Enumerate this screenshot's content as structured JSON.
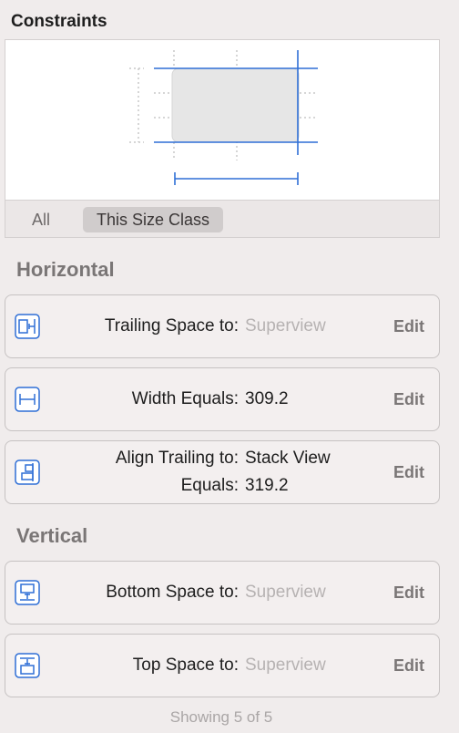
{
  "panel": {
    "title": "Constraints",
    "accent_color": "#2f6fd6"
  },
  "size_class": {
    "all_label": "All",
    "selected_label": "This Size Class"
  },
  "horizontal": {
    "title": "Horizontal",
    "items": [
      {
        "icon": "trailing-space-icon",
        "label_line1": "Trailing Space to:",
        "value_line1": "Superview",
        "value_is_placeholder": true,
        "edit_label": "Edit"
      },
      {
        "icon": "width-equals-icon",
        "label_line1": "Width Equals:",
        "value_line1": "309.2",
        "value_is_placeholder": false,
        "edit_label": "Edit"
      },
      {
        "icon": "align-trailing-icon",
        "label_line1": "Align Trailing to:",
        "label_line2": "Equals:",
        "value_line1": "Stack View",
        "value_line2": "319.2",
        "value_is_placeholder": false,
        "edit_label": "Edit"
      }
    ]
  },
  "vertical": {
    "title": "Vertical",
    "items": [
      {
        "icon": "bottom-space-icon",
        "label_line1": "Bottom Space to:",
        "value_line1": "Superview",
        "value_is_placeholder": true,
        "edit_label": "Edit"
      },
      {
        "icon": "top-space-icon",
        "label_line1": "Top Space to:",
        "value_line1": "Superview",
        "value_is_placeholder": true,
        "edit_label": "Edit"
      }
    ]
  },
  "footer": {
    "text": "Showing 5 of 5"
  }
}
